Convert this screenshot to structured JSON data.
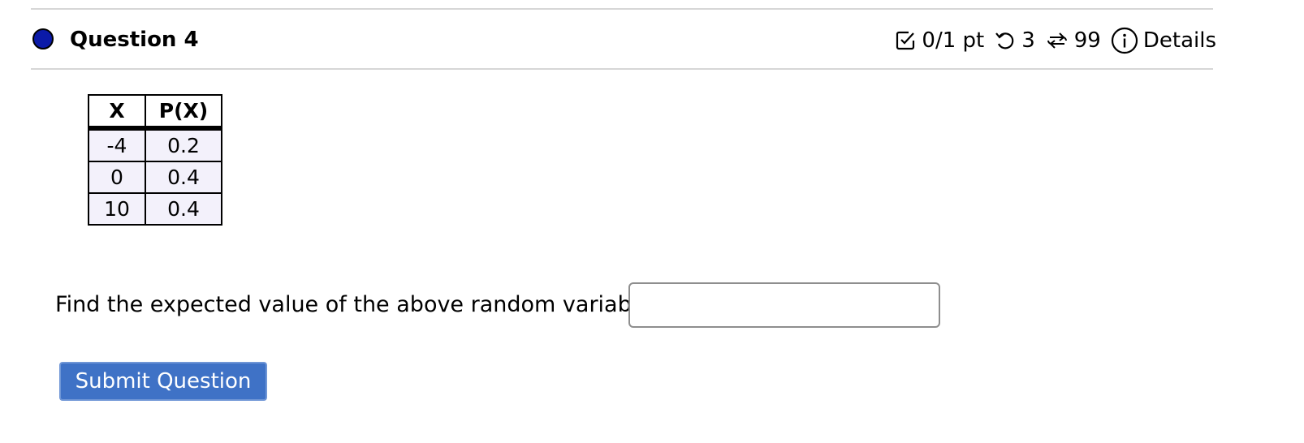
{
  "question": {
    "title": "Question 4",
    "status_color": "#0b1aa8"
  },
  "meta": {
    "score": "0/1 pt",
    "score_icon": "checkbox-check-icon",
    "attempts": "3",
    "attempts_icon": "undo-icon",
    "versions": "99",
    "versions_icon": "refresh-arrows-icon",
    "details_label": "Details",
    "details_icon": "info-circle-icon"
  },
  "table": {
    "headers": [
      "X",
      "P(X)"
    ],
    "rows": [
      [
        "-4",
        "0.2"
      ],
      [
        "0",
        "0.4"
      ],
      [
        "10",
        "0.4"
      ]
    ]
  },
  "prompt": "Find the expected value of the above random variable.",
  "answer": {
    "value": "",
    "placeholder": ""
  },
  "submit_label": "Submit Question",
  "colors": {
    "submit_bg": "#3f72c6",
    "cell_bg": "#f3f1fb",
    "divider": "#d6d6d6"
  }
}
